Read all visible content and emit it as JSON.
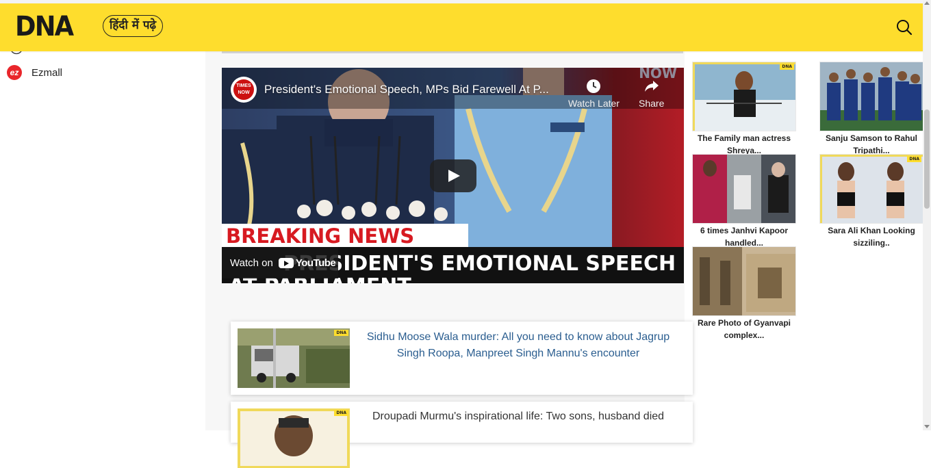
{
  "header": {
    "logo": "DNA",
    "hindi_label": "हिंदी में पढ़े",
    "search_icon": "search-icon"
  },
  "sidebar": {
    "items": [
      {
        "label": "Ezmall",
        "icon": "ezmall-icon",
        "icon_text": "ez"
      }
    ]
  },
  "video": {
    "title": "President's Emotional Speech, MPs Bid Farewell At P...",
    "channel_badge": "TIMES NOW",
    "watch_later_label": "Watch Later",
    "share_label": "Share",
    "watch_on_label": "Watch on",
    "youtube_label": "YouTube",
    "breaking_text": "BREAKING NEWS",
    "ticker_text": "PRESIDENT'S EMOTIONAL SPEECH",
    "ticker_text_2": "AT PARLIAMENT",
    "corner_tag": "NOW"
  },
  "articles": [
    {
      "title": "Sidhu Moose Wala murder: All you need to know about Jagrup Singh Roopa, Manpreet Singh Mannu's encounter",
      "badge": "DNA",
      "title_color": "#2a5d8f"
    },
    {
      "title": "Droupadi Murmu's inspirational life: Two sons, husband died",
      "badge": "DNA",
      "title_color": "#333333"
    }
  ],
  "tiles": [
    {
      "caption_1": "The Family man actress",
      "caption_2": "Shreya...",
      "badge": "DNA"
    },
    {
      "caption_1": "Sanju Samson to Rahul",
      "caption_2": "Tripathi..."
    },
    {
      "caption_1": "6 times Janhvi Kapoor",
      "caption_2": "handled..."
    },
    {
      "caption_1": "Sara Ali Khan Looking",
      "caption_2": "sizziling..",
      "badge": "DNA"
    },
    {
      "caption_1": "Rare Photo of Gyanvapi",
      "caption_2": "complex..."
    }
  ],
  "colors": {
    "header_bg": "#fedd2d",
    "breaking_red": "#d71a21",
    "link_blue": "#2a5d8f"
  }
}
